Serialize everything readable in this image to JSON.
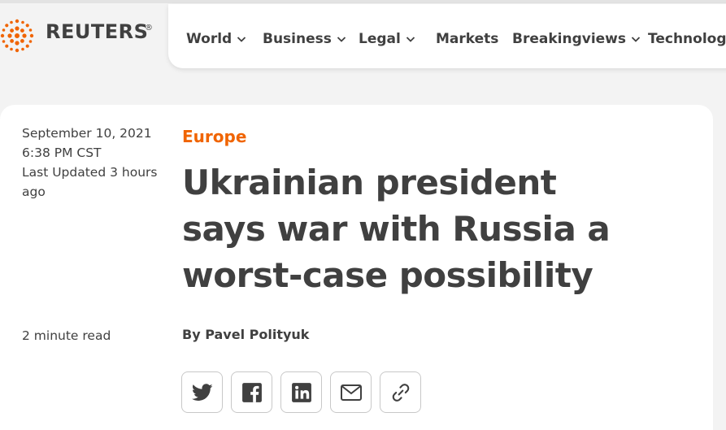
{
  "header": {
    "brand": "REUTERS",
    "brand_mark": "®",
    "nav": [
      {
        "label": "World",
        "has_menu": true
      },
      {
        "label": "Business",
        "has_menu": true
      },
      {
        "label": "Legal",
        "has_menu": true
      },
      {
        "label": "Markets",
        "has_menu": false
      },
      {
        "label": "Breakingviews",
        "has_menu": true
      },
      {
        "label": "Technology",
        "has_menu": false
      }
    ]
  },
  "article": {
    "date": "September 10, 2021",
    "time": "6:38 PM CST",
    "updated": "Last Updated 3 hours ago",
    "read_time": "2 minute read",
    "category": "Europe",
    "headline": "Ukrainian president says war with Russia a worst-case possibility",
    "byline_prefix": "By",
    "author": "Pavel Polityuk"
  },
  "share": [
    {
      "icon": "twitter-icon"
    },
    {
      "icon": "facebook-icon"
    },
    {
      "icon": "linkedin-icon"
    },
    {
      "icon": "email-icon"
    },
    {
      "icon": "link-icon"
    }
  ],
  "colors": {
    "accent": "#f06400",
    "text": "#404040",
    "background": "#f3f3f3",
    "card": "#ffffff"
  }
}
